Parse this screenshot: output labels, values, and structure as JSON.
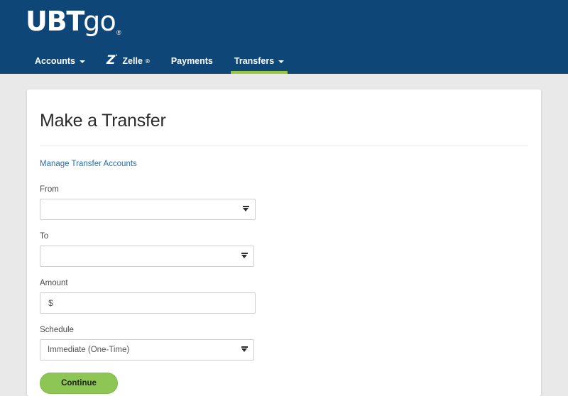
{
  "brand": {
    "logo_primary": "UBT",
    "logo_secondary": "go",
    "logo_mark": "®"
  },
  "nav": {
    "items": [
      {
        "label": "Accounts",
        "icon": "chevron-down-icon",
        "has_caret": true,
        "active": false
      },
      {
        "label": "Zelle",
        "icon": "zelle-logo-icon",
        "has_caret": false,
        "active": false,
        "registered": "®",
        "z_glyph": "Z"
      },
      {
        "label": "Payments",
        "icon": null,
        "has_caret": false,
        "active": false
      },
      {
        "label": "Transfers",
        "icon": "chevron-down-icon",
        "has_caret": true,
        "active": true
      }
    ]
  },
  "main": {
    "title": "Make a Transfer",
    "manage_link": "Manage Transfer Accounts",
    "fields": {
      "from": {
        "label": "From",
        "value": "",
        "placeholder": "",
        "type": "select",
        "arrow_icon": "dropdown-arrow-icon"
      },
      "to": {
        "label": "To",
        "value": "",
        "placeholder": "",
        "type": "select",
        "arrow_icon": "dropdown-arrow-icon"
      },
      "amount": {
        "label": "Amount",
        "prefix": "$",
        "value": "",
        "placeholder": "",
        "type": "text"
      },
      "schedule": {
        "label": "Schedule",
        "value": "Immediate (One-Time)",
        "type": "select",
        "arrow_icon": "dropdown-arrow-icon"
      }
    },
    "submit_label": "Continue"
  },
  "colors": {
    "header_navy": "#0d4677",
    "accent_green": "#97c93d",
    "button_green": "#8dc654",
    "link_blue": "#2c6ca5",
    "page_gray": "#e9e9e9"
  }
}
